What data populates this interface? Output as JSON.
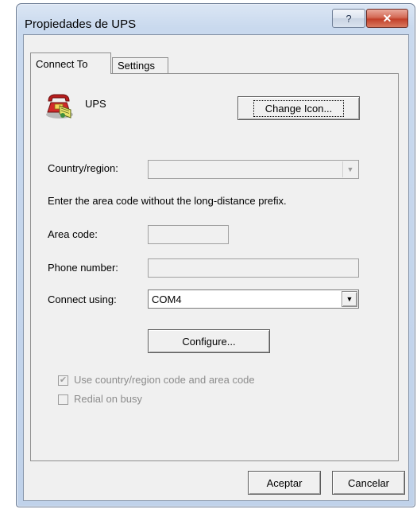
{
  "window": {
    "title": "Propiedades de UPS",
    "help_glyph": "?",
    "close_glyph": "✕"
  },
  "tabs": [
    {
      "label": "Connect To",
      "active": true
    },
    {
      "label": "Settings",
      "active": false
    }
  ],
  "connection": {
    "name": "UPS",
    "icon": "telephone-icon",
    "change_icon_label": "Change Icon..."
  },
  "country": {
    "label": "Country/region:",
    "value": ""
  },
  "hint": "Enter the area code without the long-distance prefix.",
  "area_code": {
    "label": "Area code:",
    "value": ""
  },
  "phone_number": {
    "label": "Phone number:",
    "value": ""
  },
  "connect_using": {
    "label": "Connect using:",
    "value": "COM4"
  },
  "configure_label": "Configure...",
  "use_country_code": {
    "label": "Use country/region code and area code",
    "checked": true
  },
  "redial_on_busy": {
    "label": "Redial on busy",
    "checked": false
  },
  "footer": {
    "ok_label": "Aceptar",
    "cancel_label": "Cancelar"
  },
  "colors": {
    "close_button": "#c2402a",
    "dialog_face": "#f0f0f0",
    "title_frame": "#c9d9ee"
  }
}
